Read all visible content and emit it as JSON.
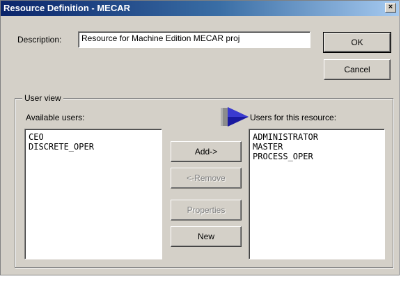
{
  "window": {
    "title": "Resource Definition - MECAR",
    "close_glyph": "×"
  },
  "description": {
    "label": "Description:",
    "value": "Resource for Machine Edition MECAR proj"
  },
  "buttons": {
    "ok": "OK",
    "cancel": "Cancel",
    "add": "Add->",
    "remove": "<-Remove",
    "properties": "Properties",
    "new": "New"
  },
  "user_view": {
    "legend": "User view",
    "available_label": "Available users:",
    "assigned_label": "Users for this resource:",
    "available_users": [
      "CEO",
      "DISCRETE_OPER"
    ],
    "resource_users": [
      "ADMINISTRATOR",
      "MASTER",
      "PROCESS_OPER"
    ]
  },
  "icons": {
    "arrow": "right-arrow-icon"
  },
  "colors": {
    "titlebar_start": "#0a246a",
    "titlebar_end": "#a6caf0",
    "dialog_bg": "#d4d0c8",
    "arrow": "#1a1aa0"
  }
}
